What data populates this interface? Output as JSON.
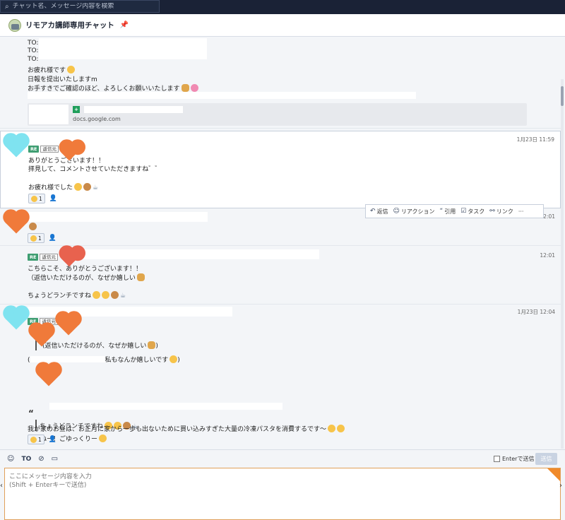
{
  "search": {
    "placeholder": "チャット名、メッセージ内容を検索"
  },
  "room": {
    "title": "リモアカ講師専用チャット"
  },
  "messages": {
    "m1": {
      "to_lines": [
        "TO:",
        "TO:",
        "TO:"
      ],
      "body": [
        "お疲れ様です",
        "日報を提出いたしますm",
        "お手すきでご確認のほど、よろしくお願いいたします"
      ],
      "preview_domain": "docs.google.com"
    },
    "m2": {
      "time": "1月23日 11:59",
      "re_badge": "RE",
      "re_label": "返信元",
      "body": [
        "ありがとうございます！！",
        "拝見して、コメントさせていただきますね゛゛",
        "お疲れ様でした"
      ],
      "reaction_count": "1"
    },
    "m3": {
      "time": "12:01",
      "reaction_count": "1"
    },
    "m4": {
      "time": "12:01",
      "re_badge": "RE",
      "re_label": "返信元",
      "body": [
        "こちらこそ、ありがとうございます！！",
        "（返信いただけるのが、なぜか嬉しい",
        "ちょうどランチですね"
      ]
    },
    "m5": {
      "time": "1月23日 12:04",
      "re_badge": "RE",
      "re_label": "返信元",
      "quote_mark": "“",
      "quote1": "(返信いただけるのが、なぜか嬉しい",
      "quote1_end": ")",
      "line2_start": "(",
      "line2": "私もなんか嬉しいです",
      "line2_end": ")",
      "quote2": "ちょうどランチですね",
      "line3": "ですねー！ごゆっくりー",
      "line4": "我が家のお昼は、お正月に家から一歩も出ないために買い込みすぎた大量の冷凍パスタを消費するです〜",
      "reaction_count": "1"
    }
  },
  "actions": [
    {
      "label": "返信",
      "icon": "reply-icon",
      "glyph": "↶"
    },
    {
      "label": "リアクション",
      "icon": "smile-icon",
      "glyph": "☺"
    },
    {
      "label": "引用",
      "icon": "quote-icon",
      "glyph": "“"
    },
    {
      "label": "タスク",
      "icon": "task-icon",
      "glyph": "☑"
    },
    {
      "label": "リンク",
      "icon": "link-icon",
      "glyph": "⚯"
    },
    {
      "label": "···",
      "icon": "more-icon",
      "glyph": ""
    }
  ],
  "composer": {
    "to_label": "TO",
    "enter_send_label": "Enterで送信",
    "send_label": "送信",
    "placeholder": "ここにメッセージ内容を入力\n(Shift + Enterキーで送信)"
  },
  "colors": {
    "header_bg": "#1a2236",
    "accent_green": "#3f9e72",
    "composer_border": "#e0a05a"
  }
}
